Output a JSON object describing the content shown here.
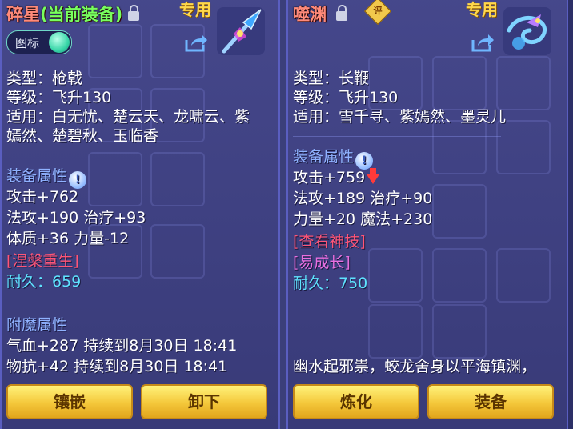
{
  "left": {
    "title": "碎星",
    "title_status": "(当前装备)",
    "special_label": "专用",
    "toggle_label": "图标",
    "type_line": "类型：枪戟",
    "level_line": "等级：飞升130",
    "suit_line1": "适用：白无忧、楚云天、龙啸云、紫",
    "suit_line2": "嫣然、楚碧秋、玉临香",
    "attr_header": "装备属性",
    "attr_lines": [
      "攻击+762",
      "法攻+190 治疗+93",
      "体质+36 力量-12"
    ],
    "skill": "[涅槃重生]",
    "durability": "耐久：659",
    "enchant_header": "附魔属性",
    "enchant_lines": [
      "气血+287 持续到8月30日 18:41",
      "物抗+42 持续到8月30日 18:41"
    ],
    "buttons": [
      "镶嵌",
      "卸下"
    ]
  },
  "right": {
    "title": "噬渊",
    "ping": "评",
    "special_label": "专用",
    "type_line": "类型：长鞭",
    "level_line": "等级：飞升130",
    "suit_line": "适用：雪千寻、紫嫣然、墨灵儿",
    "attr_header": "装备属性",
    "attr_lines": [
      "攻击+759",
      "法攻+189 治疗+90",
      "力量+20 魔法+230"
    ],
    "view_skill": "[查看神技]",
    "growth": "[易成长]",
    "durability": "耐久：750",
    "desc": "幽水起邪祟，蛟龙舍身以平海镇渊，",
    "buttons": [
      "炼化",
      "装备"
    ]
  },
  "colors": {
    "title": "#ff8a7a",
    "current": "#78ff5e",
    "section": "#8fb2ff",
    "skill": "#ff5577",
    "growth": "#e86fe0",
    "durability": "#5fe3ff",
    "button": "#f4c73a"
  }
}
